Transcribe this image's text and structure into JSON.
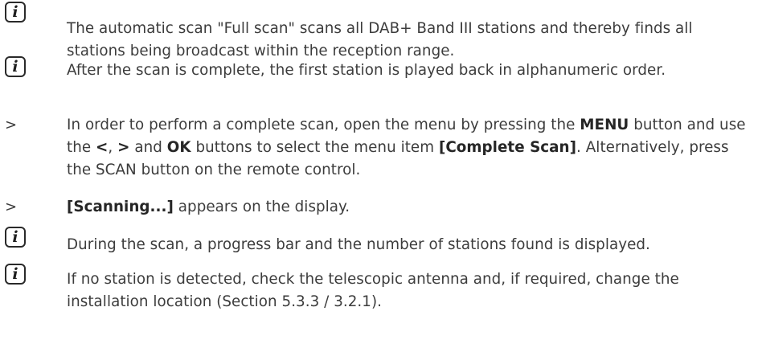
{
  "items": [
    {
      "type": "info",
      "icon": "info-icon",
      "text": "The automatic scan \"Full scan\" scans all DAB+ Band III stations and thereby finds all stations being broadcast within the reception range."
    },
    {
      "type": "info",
      "icon": "info-icon",
      "text": "After the scan is complete, the first station is played back in alphanumeric order."
    },
    {
      "type": "step",
      "marker": ">",
      "parts": {
        "p1": "In order to perform a complete scan, open the menu by pressing the ",
        "menu": "MENU",
        "p2": " button and use the ",
        "left": "<",
        "p3": ", ",
        "right": ">",
        "p4": " and ",
        "ok": "OK",
        "p5": " buttons to select the menu item ",
        "complete_scan": "[Complete Scan]",
        "p6": ". Alternatively, press the SCAN button on the remote control."
      }
    },
    {
      "type": "step",
      "marker": ">",
      "parts": {
        "scanning": "[Scanning...]",
        "p1": " appears on the display."
      }
    },
    {
      "type": "info",
      "icon": "info-icon",
      "text": "During the scan, a progress bar and the number of stations found is displayed."
    },
    {
      "type": "info",
      "icon": "info-icon",
      "text": "If no station is detected, check the telescopic antenna and, if required, change the installation location (Section 5.3.3 / 3.2.1)."
    }
  ],
  "icon_glyph": "i"
}
